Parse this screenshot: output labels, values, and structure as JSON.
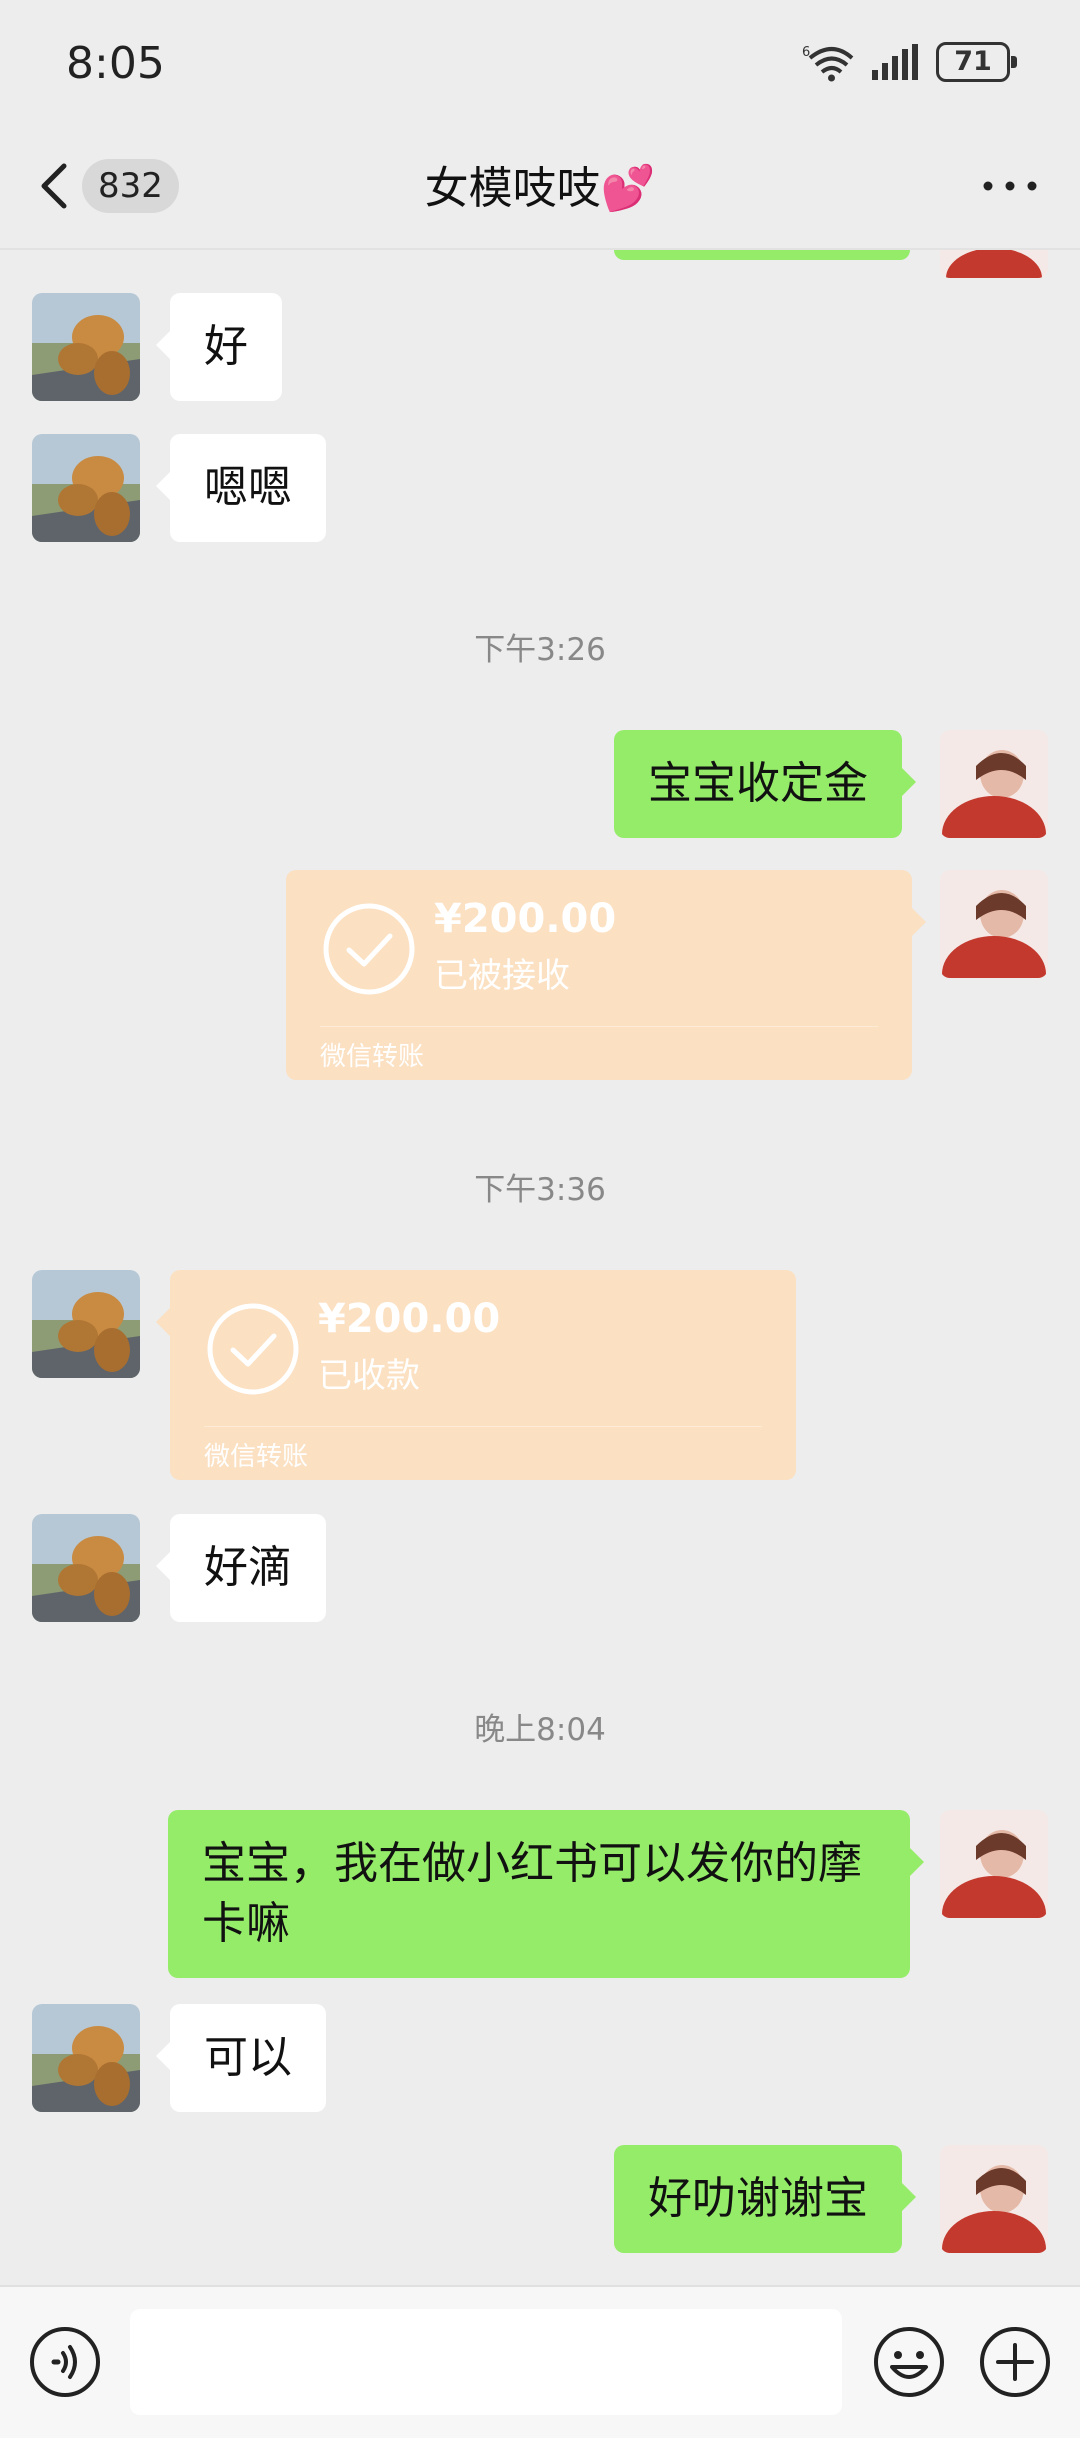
{
  "status_bar": {
    "time": "8:05",
    "battery": "71"
  },
  "header": {
    "unread_count": "832",
    "title": "女模吱吱💕"
  },
  "messages": [
    {
      "side": "left",
      "text": "好"
    },
    {
      "side": "left",
      "text": "嗯嗯"
    },
    {
      "timestamp": "下午3:26"
    },
    {
      "side": "right",
      "text": "宝宝收定金"
    },
    {
      "side": "right",
      "type": "transfer",
      "amount": "¥200.00",
      "status": "已被接收",
      "label": "微信转账"
    },
    {
      "timestamp": "下午3:36"
    },
    {
      "side": "left",
      "type": "transfer",
      "amount": "¥200.00",
      "status": "已收款",
      "label": "微信转账"
    },
    {
      "side": "left",
      "text": "好滴"
    },
    {
      "timestamp": "晚上8:04"
    },
    {
      "side": "right",
      "text_line1": "宝宝，我在做小红书可以发你的摩",
      "text_line2": "卡嘛"
    },
    {
      "side": "left",
      "text": "可以"
    },
    {
      "side": "right",
      "text": "好叻谢谢宝"
    }
  ],
  "input_bar": {
    "voice_icon": "voice-icon",
    "emoji_icon": "emoji-icon",
    "plus_icon": "plus-icon"
  },
  "colors": {
    "sent_bubble": "#95ec69",
    "received_bubble": "#ffffff",
    "transfer_accepted": "#fbe0c2",
    "background": "#ededed"
  }
}
